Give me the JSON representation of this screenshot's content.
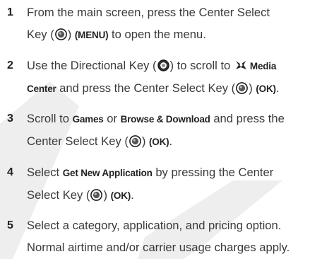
{
  "watermark_color": "#eeeeee",
  "steps": [
    {
      "number": "1",
      "parts": [
        {
          "t": "From the main screen, press the Center Select"
        },
        {
          "br": true
        },
        {
          "t": "Key ("
        },
        {
          "icon": "center-select-key-icon"
        },
        {
          "t": ") "
        },
        {
          "b": "(MENU)"
        },
        {
          "t": " to open the menu."
        }
      ]
    },
    {
      "number": "2",
      "parts": [
        {
          "t": "Use the Directional Key ("
        },
        {
          "icon": "directional-key-icon"
        },
        {
          "t": ") to scroll to "
        },
        {
          "icon": "media-center-icon"
        },
        {
          "b": "Media"
        },
        {
          "br": true
        },
        {
          "b": "Center"
        },
        {
          "t": " and press the Center Select Key ("
        },
        {
          "icon": "center-select-key-icon"
        },
        {
          "t": ") "
        },
        {
          "b": "(OK)"
        },
        {
          "t": "."
        }
      ]
    },
    {
      "number": "3",
      "parts": [
        {
          "t": "Scroll to "
        },
        {
          "b": "Games"
        },
        {
          "t": " or "
        },
        {
          "b": "Browse & Download"
        },
        {
          "t": " and press the"
        },
        {
          "br": true
        },
        {
          "t": "Center Select Key ("
        },
        {
          "icon": "center-select-key-icon"
        },
        {
          "t": ") "
        },
        {
          "b": "(OK)"
        },
        {
          "t": "."
        }
      ]
    },
    {
      "number": "4",
      "parts": [
        {
          "t": "Select "
        },
        {
          "b": "Get New Application"
        },
        {
          "t": " by pressing the Center"
        },
        {
          "br": true
        },
        {
          "t": "Select Key ("
        },
        {
          "icon": "center-select-key-icon"
        },
        {
          "t": ") "
        },
        {
          "b": "(OK)"
        },
        {
          "t": "."
        }
      ]
    },
    {
      "number": "5",
      "parts": [
        {
          "t": "Select a category, application, and pricing option."
        },
        {
          "br": true
        },
        {
          "t": "Normal airtime and/or carrier usage charges apply."
        }
      ]
    }
  ]
}
